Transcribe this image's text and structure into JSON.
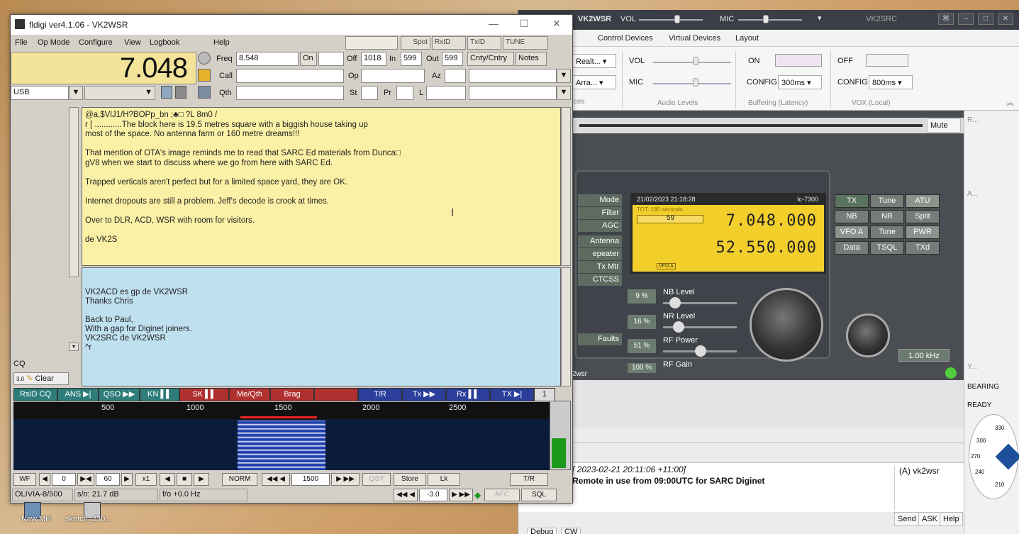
{
  "rig": {
    "title": "VK2WSR",
    "vol": "VOL",
    "mic": "MIC",
    "right_title": "VK2SRC",
    "menu": [
      "Control Devices",
      "Virtual Devices",
      "Layout"
    ],
    "ribbon": {
      "dd1": "Realt...",
      "dd2": "Arra...",
      "vol": "VOL",
      "mic": "MIC",
      "on": "ON",
      "off": "OFF",
      "config1": "CONFIG",
      "config1_val": "300ms",
      "config2": "CONFIG",
      "config2_val": "800ms",
      "audio_levels": "Audio Levels",
      "buffering": "Buffering (Latency)",
      "vox": "VOX (Local)",
      "ces": "ces"
    },
    "mute": "Mute",
    "left_buttons": [
      "Mode",
      "Filter",
      "AGC",
      "Antenna",
      "epeater Shift",
      "Tx Mtr",
      "CTCSS",
      "Faults"
    ],
    "lcd": {
      "datetime": "21/02/2023 21:18:28",
      "model": "Ic-7300",
      "tot": "TOT: 180 seconds",
      "smeter": "59",
      "freq_a": "7.048.000",
      "freq_b": "52.550.000",
      "vfo": "VFO A"
    },
    "grid": [
      [
        "TX",
        "Tune",
        "ATU"
      ],
      [
        "NB",
        "NR",
        "Split"
      ],
      [
        "VFO A",
        "Tone",
        "PWR"
      ],
      [
        "Data",
        "TSQL",
        "TXd"
      ]
    ],
    "levels": [
      {
        "pct": "9 %",
        "label": "NB Level",
        "value": 0.1
      },
      {
        "pct": "16 %",
        "label": "NR Level",
        "value": 0.16
      },
      {
        "pct": "51 %",
        "label": "RF Power",
        "value": 0.51
      },
      {
        "pct": "100 %",
        "label": "RF Gain",
        "value": 1.0
      }
    ],
    "khz": "1.00 kHz",
    "callsign_tag": "2wsr",
    "chat_ts": "[ 2023-02-21 20:11:06 +11:00]",
    "chat_msg": "Remote in use from 09:00UTC for SARC Diginet",
    "user": "(A) vk2wsr",
    "send": "Send",
    "ask": "ASK",
    "help": "Help",
    "tabs": [
      "Debug",
      "CW"
    ],
    "side": {
      "bearing": "BEARING",
      "ready": "READY",
      "deg1": "330",
      "deg2": "300",
      "deg3": "270",
      "deg4": "240",
      "deg5": "210",
      "r_label": "R...",
      "a_label": "A...",
      "y_label": "Y..."
    }
  },
  "fl": {
    "title": "fldigi ver4.1.06 - VK2WSR",
    "menu": [
      "File",
      "Op Mode",
      "Configure",
      "View",
      "Logbook",
      "Help"
    ],
    "spot": "Spot",
    "rxid": "RxID",
    "txid": "TxID",
    "tune": "TUNE",
    "big_freq": "7.048",
    "freq_lbl": "Freq",
    "freq_val": "8.548",
    "on_lbl": "On",
    "off_lbl": "Off",
    "off_val": "1018",
    "in_lbl": "In",
    "in_val": "599",
    "out_lbl": "Out",
    "out_val": "599",
    "cnty": "Cnty/Cntry",
    "notes": "Notes",
    "call_lbl": "Call",
    "op_lbl": "Op",
    "az_lbl": "Az",
    "mode": "USB",
    "qth_lbl": "Qth",
    "st_lbl": "St",
    "pr_lbl": "Pr",
    "l_lbl": "L",
    "rx_lines": [
      "@a,$VlJ1/H?BOPp_bn ;♣□ ?L  8m0    /",
      "r  [   ............The block here is 19.5 metres square with a biggish house taking up",
      "most of the space. No antenna farm or 160 metre dreams!!!",
      "",
      "That mention of OTA's image reminds me to read that SARC Ed materials from Dunca□",
      "gV8 when we start to discuss where we go from here with SARC Ed.",
      "",
      "Trapped verticals aren't perfect but for a limited space yard, they are OK.",
      "",
      "Internet dropouts are still a problem. Jeff's decode is crook at times.",
      "",
      "Over to DLR, ACD, WSR with room for visitors.",
      "",
      "de VK2S"
    ],
    "tx_lines": [
      "VK2ACD es gp de VK2WSR",
      "Thanks Chris",
      "",
      "Back to Paul,",
      "With a gap for Diginet joiners.",
      "VK2SRC de VK2WSR",
      "^r"
    ],
    "cq": "CQ",
    "clear": "Clear",
    "macros": [
      {
        "label": "RsID CQ",
        "color": "#2e7d7a"
      },
      {
        "label": "ANS ▶|",
        "color": "#2e7d7a"
      },
      {
        "label": "QSO ▶▶",
        "color": "#2e7d7a"
      },
      {
        "label": "KN ▌▌",
        "color": "#2e7d7a"
      },
      {
        "label": "SK ▌▌",
        "color": "#b03030"
      },
      {
        "label": "Me/Qth",
        "color": "#b03030"
      },
      {
        "label": "Brag",
        "color": "#b03030"
      },
      {
        "label": "",
        "color": "#b03030"
      },
      {
        "label": "T/R",
        "color": "#2a3e9a"
      },
      {
        "label": "Tx ▶▶",
        "color": "#2a3e9a"
      },
      {
        "label": "Rx ▌▌",
        "color": "#2a3e9a"
      },
      {
        "label": "TX ▶|",
        "color": "#2a3e9a"
      },
      {
        "label": "1",
        "color": "#dddddd"
      }
    ],
    "scale": [
      "500",
      "1000",
      "1500",
      "2000",
      "2500"
    ],
    "wf_controls": {
      "wf": "WF",
      "v0": "0",
      "v60": "60",
      "x1": "x1",
      "norm": "NORM",
      "f1500": "1500",
      "qsy": "QSY",
      "store": "Store",
      "lk": "Lk",
      "tr": "T/R",
      "neg3": "-3.0",
      "afc": "AFC",
      "sql": "SQL"
    },
    "status": {
      "mode": "OLIVIA-8/500",
      "sn": "s/n: 21.7 dB",
      "fo": "f/o +0.0 Hz",
      "small": "3.0"
    }
  },
  "desktop": {
    "icons": [
      "New Mill",
      "sketch_230..."
    ]
  }
}
